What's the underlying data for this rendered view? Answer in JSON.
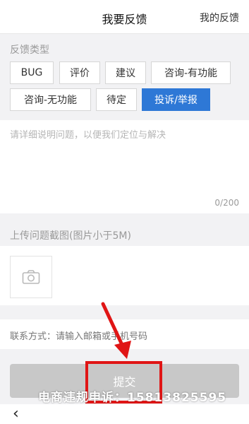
{
  "header": {
    "title": "我要反馈",
    "right_link": "我的反馈"
  },
  "feedback_type": {
    "label": "反馈类型",
    "options": [
      "BUG",
      "评价",
      "建议",
      "咨询-有功能",
      "咨询-无功能",
      "待定",
      "投诉/举报"
    ],
    "selected": "投诉/举报"
  },
  "description": {
    "placeholder": "请详细说明问题，以便我们定位与解决",
    "counter": "0/200"
  },
  "upload": {
    "label": "上传问题截图(图片小于5M)",
    "icon": "camera-icon"
  },
  "contact": {
    "placeholder": "联系方式：请输入邮箱或手机号码"
  },
  "submit": {
    "label": "提交"
  },
  "overlay": {
    "watermark": "电商违规申诉：15813825595",
    "highlight_color": "#e01515"
  },
  "footer": {
    "back_icon": "chevron-left-icon"
  },
  "colors": {
    "accent": "#2e78d6",
    "background": "#f2f2f4"
  }
}
